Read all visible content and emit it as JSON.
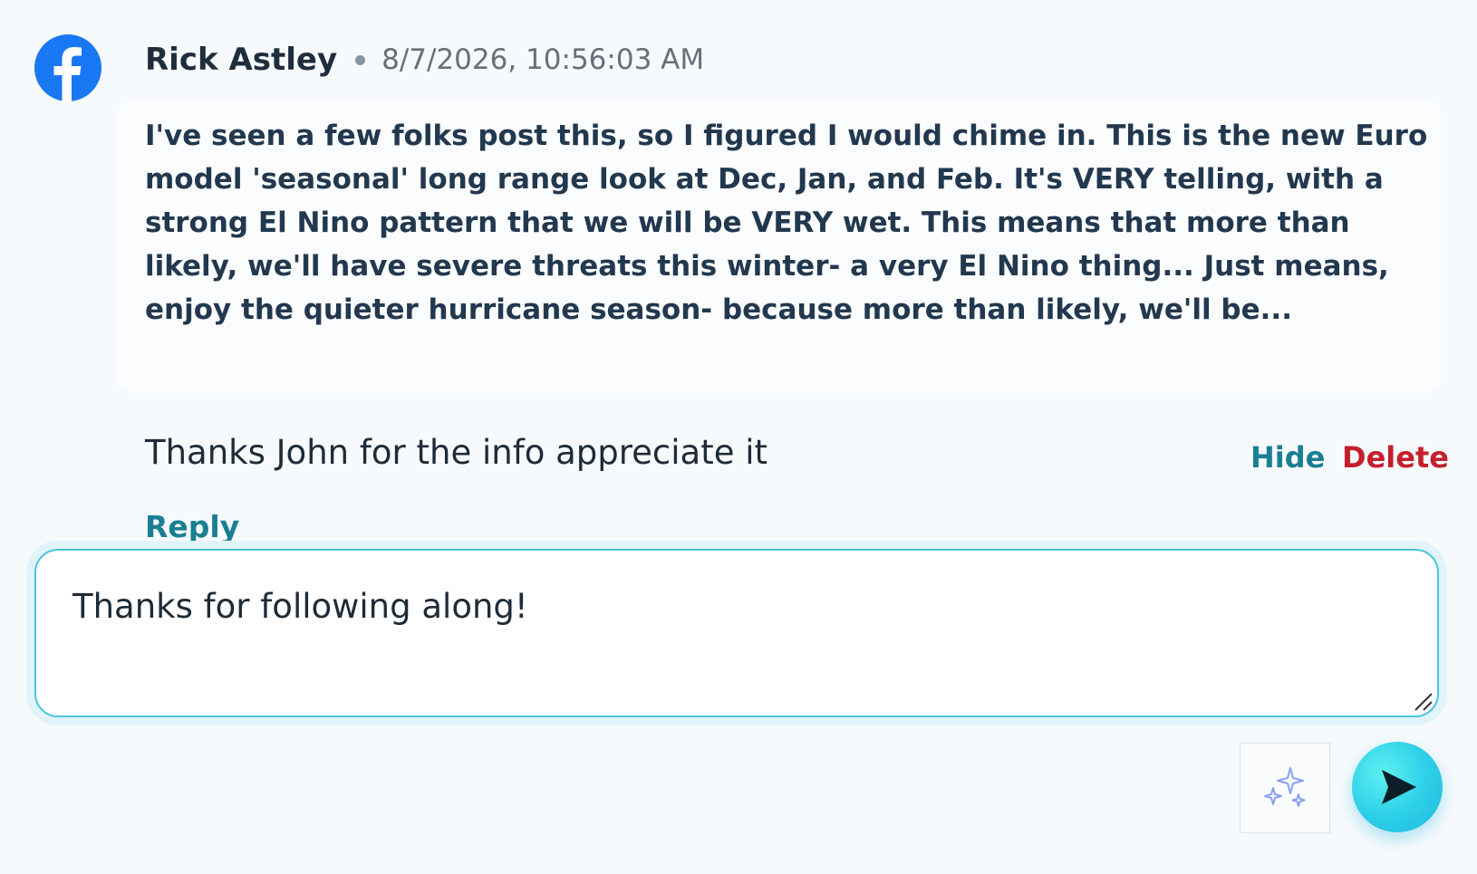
{
  "comment": {
    "platform_icon": "facebook-icon",
    "author": "Rick Astley",
    "timestamp": "8/7/2026, 10:56:03 AM",
    "post_excerpt": "I've seen a few folks post this, so I figured I would chime in. This is the new Euro model 'seasonal' long range look at Dec, Jan, and Feb. It's VERY telling, with a strong El Nino pattern that we will be VERY wet. This means that more than likely, we'll have severe threats this winter- a very El Nino thing... Just means, enjoy the quieter hurricane season- because more than likely, we'll be...",
    "text": "Thanks John for the info appreciate it",
    "hide_label": "Hide",
    "delete_label": "Delete",
    "reply_label": "Reply"
  },
  "reply_box": {
    "value": "Thanks for following along!",
    "ai_icon": "sparkles-icon",
    "send_icon": "send-icon"
  },
  "colors": {
    "accent": "#1a7f94",
    "danger": "#c4202c",
    "facebook_blue": "#1877f2",
    "focus_border": "#45c6df"
  }
}
